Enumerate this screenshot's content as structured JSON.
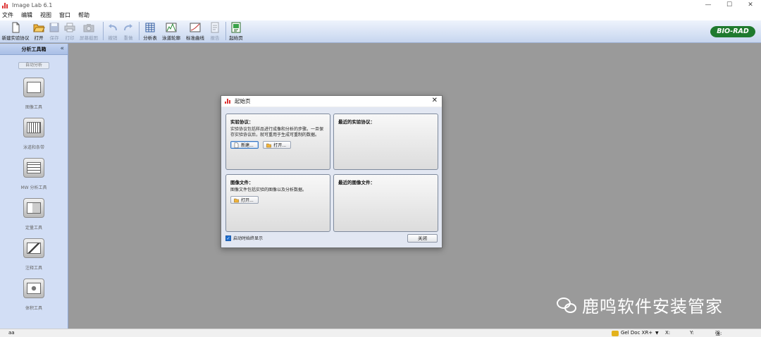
{
  "window": {
    "title": "Image Lab 6.1",
    "minimize": "—",
    "maximize": "☐",
    "close": "✕"
  },
  "menu": [
    "文件",
    "编辑",
    "视图",
    "窗口",
    "帮助"
  ],
  "toolbar": {
    "items": [
      {
        "label": "新建实验协议",
        "icon": "new-document-icon",
        "enabled": true
      },
      {
        "label": "打开",
        "icon": "open-folder-icon",
        "enabled": true
      },
      {
        "label": "保存",
        "icon": "save-icon",
        "enabled": false
      },
      {
        "label": "打印",
        "icon": "print-icon",
        "enabled": false
      },
      {
        "label": "屏幕截图",
        "icon": "camera-icon",
        "enabled": false
      },
      {
        "label": "撤销",
        "icon": "undo-icon",
        "enabled": false
      },
      {
        "label": "重做",
        "icon": "redo-icon",
        "enabled": false
      },
      {
        "label": "分析表",
        "icon": "table-icon",
        "enabled": true
      },
      {
        "label": "泳道轮廓",
        "icon": "lane-profile-icon",
        "enabled": true
      },
      {
        "label": "标准曲线",
        "icon": "standard-curve-icon",
        "enabled": true
      },
      {
        "label": "报告",
        "icon": "report-icon",
        "enabled": false
      },
      {
        "label": "起始页",
        "icon": "start-page-icon",
        "enabled": true
      }
    ],
    "brand": "BIO-RAD",
    "brand_color": "#1f7a2e"
  },
  "sidebar": {
    "title": "分析工具箱",
    "collapse": "«",
    "auto_button": "自动分析",
    "tools": [
      {
        "label": "图像工具",
        "icon": "image-tools-icon"
      },
      {
        "label": "泳道和条带",
        "icon": "lanes-bands-icon"
      },
      {
        "label": "MW 分析工具",
        "icon": "mw-analysis-icon"
      },
      {
        "label": "定量工具",
        "icon": "quantity-tools-icon"
      },
      {
        "label": "注释工具",
        "icon": "annotation-tools-icon"
      },
      {
        "label": "体积工具",
        "icon": "volume-tools-icon"
      }
    ]
  },
  "dialog": {
    "title": "起始页",
    "close": "✕",
    "protocol": {
      "heading": "实验协议：",
      "description": "实验协议包括样品进行成像和分析的步骤。一旦保存实验协议后，就可重用于生成可重制的数据。",
      "new_button": "新建...",
      "open_button": "打开..."
    },
    "recent_protocols": {
      "heading": "最近的实验协议："
    },
    "image_file": {
      "heading": "图像文件：",
      "description": "图像文件包括实验的图像以及分析数据。",
      "open_button": "打开..."
    },
    "recent_images": {
      "heading": "最近的图像文件："
    },
    "startup_checkbox": {
      "label": "启动时始终显示",
      "checked": true
    },
    "close_button": "关闭"
  },
  "watermark": {
    "text": "鹿鸣软件安装管家"
  },
  "status": {
    "left": "aa",
    "device": "Gel Doc XR+",
    "device_dropdown": "▼",
    "x_label": "X:",
    "y_label": "Y:",
    "intensity_label": "强:"
  }
}
